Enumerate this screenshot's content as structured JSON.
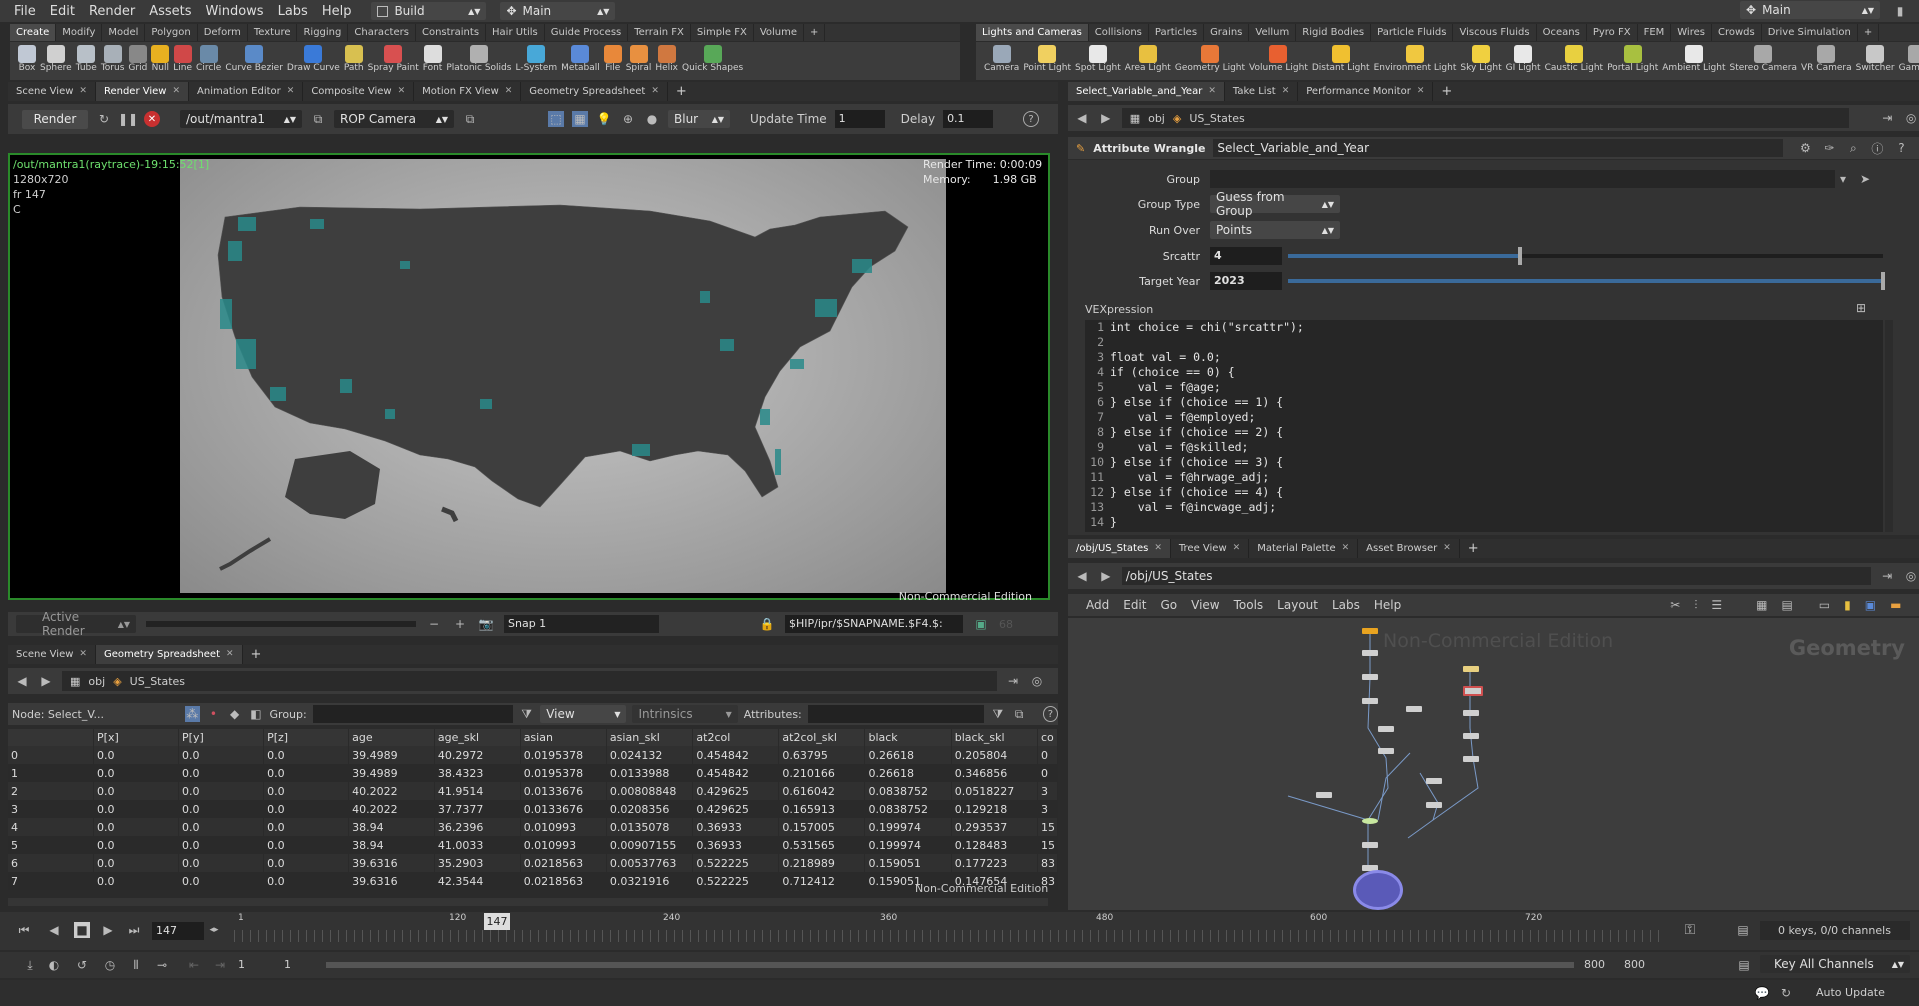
{
  "menu": {
    "items": [
      "File",
      "Edit",
      "Render",
      "Assets",
      "Windows",
      "Labs",
      "Help"
    ],
    "build": "Build",
    "desktop": "Main",
    "right_desktop": "Main"
  },
  "shelf_left": {
    "tabs": [
      "Create",
      "Modify",
      "Model",
      "Polygon",
      "Deform",
      "Texture",
      "Rigging",
      "Characters",
      "Constraints",
      "Hair Utils",
      "Guide Process",
      "Terrain FX",
      "Simple FX",
      "Volume"
    ],
    "tools": [
      {
        "name": "Box",
        "color": "#c0c8d4"
      },
      {
        "name": "Sphere",
        "color": "#d0d0d0"
      },
      {
        "name": "Tube",
        "color": "#b8c0c8"
      },
      {
        "name": "Torus",
        "color": "#a8b0b8"
      },
      {
        "name": "Grid",
        "color": "#888"
      },
      {
        "name": "Null",
        "color": "#e8b020"
      },
      {
        "name": "Line",
        "color": "#d04848"
      },
      {
        "name": "Circle",
        "color": "#6a8aa8"
      },
      {
        "name": "Curve Bezier",
        "color": "#5a8ac8"
      },
      {
        "name": "Draw Curve",
        "color": "#3a7ad8"
      },
      {
        "name": "Path",
        "color": "#d8c050"
      },
      {
        "name": "Spray Paint",
        "color": "#d85050"
      },
      {
        "name": "Font",
        "color": "#dddddd"
      },
      {
        "name": "Platonic Solids",
        "color": "#b0b0b0"
      },
      {
        "name": "L-System",
        "color": "#48a8d8"
      },
      {
        "name": "Metaball",
        "color": "#5a8ad8"
      },
      {
        "name": "File",
        "color": "#e8883a"
      },
      {
        "name": "Spiral",
        "color": "#e89040"
      },
      {
        "name": "Helix",
        "color": "#d07840"
      },
      {
        "name": "Quick Shapes",
        "color": "#58a858"
      }
    ]
  },
  "shelf_right": {
    "tabs": [
      "Lights and Cameras",
      "Collisions",
      "Particles",
      "Grains",
      "Vellum",
      "Rigid Bodies",
      "Particle Fluids",
      "Viscous Fluids",
      "Oceans",
      "Pyro FX",
      "FEM",
      "Wires",
      "Crowds",
      "Drive Simulation"
    ],
    "tools": [
      {
        "name": "Camera",
        "color": "#9aa8b8"
      },
      {
        "name": "Point Light",
        "color": "#f0d060"
      },
      {
        "name": "Spot Light",
        "color": "#e8e8e8"
      },
      {
        "name": "Area Light",
        "color": "#e8c040"
      },
      {
        "name": "Geometry Light",
        "color": "#e87838"
      },
      {
        "name": "Volume Light",
        "color": "#e86030"
      },
      {
        "name": "Distant Light",
        "color": "#f0c030"
      },
      {
        "name": "Environment Light",
        "color": "#f0c840"
      },
      {
        "name": "Sky Light",
        "color": "#f0d040"
      },
      {
        "name": "GI Light",
        "color": "#e8e8e8"
      },
      {
        "name": "Caustic Light",
        "color": "#e8d040"
      },
      {
        "name": "Portal Light",
        "color": "#a8c040"
      },
      {
        "name": "Ambient Light",
        "color": "#e8e8e8"
      },
      {
        "name": "Stereo Camera",
        "color": "#a8a8a8"
      },
      {
        "name": "VR Camera",
        "color": "#a8a8a8"
      },
      {
        "name": "Switcher",
        "color": "#c8c8c8"
      },
      {
        "name": "Gam Ca",
        "color": "#a8a8a8"
      }
    ]
  },
  "render_view": {
    "tabs": [
      "Scene View",
      "Render View",
      "Animation Editor",
      "Composite View",
      "Motion FX View",
      "Geometry Spreadsheet"
    ],
    "active_tab": "Render View",
    "render_btn": "Render",
    "rop_path": "/out/mantra1",
    "camera": "ROP Camera",
    "blur": "Blur",
    "update_time_label": "Update Time",
    "update_time": "1",
    "delay_label": "Delay",
    "delay": "0.1",
    "overlay_title": "/out/mantra1(raytrace)-19:15:52[1]",
    "res": "1280x720",
    "frame": "fr 147",
    "channel": "C",
    "render_time": "Render Time: 0:00:09",
    "memory_label": "Memory:",
    "memory": "1.98 GB",
    "watermark": "Non-Commercial Edition",
    "active_render": "Active Render",
    "snap": "Snap 1",
    "snap_path": "$HIP/ipr/$SNAPNAME.$F4.$:",
    "snap_num": "68"
  },
  "spreadsheet": {
    "tabs": [
      "Scene View",
      "Geometry Spreadsheet"
    ],
    "path_obj": "obj",
    "path_node": "US_States",
    "node_label": "Node: Select_V...",
    "group_label": "Group:",
    "view_label": "View",
    "intrinsics": "Intrinsics",
    "attributes_label": "Attributes:",
    "columns": [
      "",
      "P[x]",
      "P[y]",
      "P[z]",
      "age",
      "age_skl",
      "asian",
      "asian_skl",
      "at2col",
      "at2col_skl",
      "black",
      "black_skl",
      "co"
    ],
    "rows": [
      [
        "0",
        "0.0",
        "0.0",
        "0.0",
        "39.4989",
        "40.2972",
        "0.0195378",
        "0.024132",
        "0.454842",
        "0.63795",
        "0.26618",
        "0.205804",
        "0"
      ],
      [
        "1",
        "0.0",
        "0.0",
        "0.0",
        "39.4989",
        "38.4323",
        "0.0195378",
        "0.0133988",
        "0.454842",
        "0.210166",
        "0.26618",
        "0.346856",
        "0"
      ],
      [
        "2",
        "0.0",
        "0.0",
        "0.0",
        "40.2022",
        "41.9514",
        "0.0133676",
        "0.00808848",
        "0.429625",
        "0.616042",
        "0.0838752",
        "0.0518227",
        "3"
      ],
      [
        "3",
        "0.0",
        "0.0",
        "0.0",
        "40.2022",
        "37.7377",
        "0.0133676",
        "0.0208356",
        "0.429625",
        "0.165913",
        "0.0838752",
        "0.129218",
        "3"
      ],
      [
        "4",
        "0.0",
        "0.0",
        "0.0",
        "38.94",
        "36.2396",
        "0.010993",
        "0.0135078",
        "0.36933",
        "0.157005",
        "0.199974",
        "0.293537",
        "15"
      ],
      [
        "5",
        "0.0",
        "0.0",
        "0.0",
        "38.94",
        "41.0033",
        "0.010993",
        "0.00907155",
        "0.36933",
        "0.531565",
        "0.199974",
        "0.128483",
        "15"
      ],
      [
        "6",
        "0.0",
        "0.0",
        "0.0",
        "39.6316",
        "35.2903",
        "0.0218563",
        "0.00537763",
        "0.522225",
        "0.218989",
        "0.159051",
        "0.177223",
        "83"
      ],
      [
        "7",
        "0.0",
        "0.0",
        "0.0",
        "39.6316",
        "42.3544",
        "0.0218563",
        "0.0321916",
        "0.522225",
        "0.712412",
        "0.159051",
        "0.147654",
        "83"
      ]
    ],
    "watermark": "Non-Commercial Edition"
  },
  "params": {
    "tabs": [
      "Select_Variable_and_Year",
      "Take List",
      "Performance Monitor"
    ],
    "path_obj": "obj",
    "path_node": "US_States",
    "node_type": "Attribute Wrangle",
    "node_name": "Select_Variable_and_Year",
    "group_label": "Group",
    "group_type_label": "Group Type",
    "group_type": "Guess from Group",
    "run_over_label": "Run Over",
    "run_over": "Points",
    "srcattr_label": "Srcattr",
    "srcattr": "4",
    "srcattr_frac": 0.39,
    "target_year_label": "Target Year",
    "target_year": "2023",
    "target_year_frac": 1.0,
    "vex_label": "VEXpression",
    "code": [
      {
        "n": "1",
        "t": "int choice = chi(\"srcattr\");"
      },
      {
        "n": "2",
        "t": ""
      },
      {
        "n": "3",
        "t": "float val = 0.0;"
      },
      {
        "n": "4",
        "t": "if (choice == 0) {"
      },
      {
        "n": "5",
        "t": "    val = f@age;"
      },
      {
        "n": "6",
        "t": "} else if (choice == 1) {"
      },
      {
        "n": "7",
        "t": "    val = f@employed;"
      },
      {
        "n": "8",
        "t": "} else if (choice == 2) {"
      },
      {
        "n": "9",
        "t": "    val = f@skilled;"
      },
      {
        "n": "10",
        "t": "} else if (choice == 3) {"
      },
      {
        "n": "11",
        "t": "    val = f@hrwage_adj;"
      },
      {
        "n": "12",
        "t": "} else if (choice == 4) {"
      },
      {
        "n": "13",
        "t": "    val = f@incwage_adj;"
      },
      {
        "n": "14",
        "t": "}"
      }
    ]
  },
  "network": {
    "tabs": [
      "/obj/US_States",
      "Tree View",
      "Material Palette",
      "Asset Browser"
    ],
    "path": "/obj/US_States",
    "menu": [
      "Add",
      "Edit",
      "Go",
      "View",
      "Tools",
      "Layout",
      "Labs",
      "Help"
    ],
    "watermark": "Non-Commercial Edition",
    "context": "Geometry"
  },
  "timeline": {
    "frame": "147",
    "marker": "147",
    "ticks": [
      "1",
      "120",
      "240",
      "360",
      "480",
      "600",
      "720"
    ],
    "start": "1",
    "start2": "1",
    "end": "800",
    "end2": "800",
    "keys": "0 keys, 0/0 channels",
    "key_all": "Key All Channels",
    "auto_update": "Auto Update"
  }
}
